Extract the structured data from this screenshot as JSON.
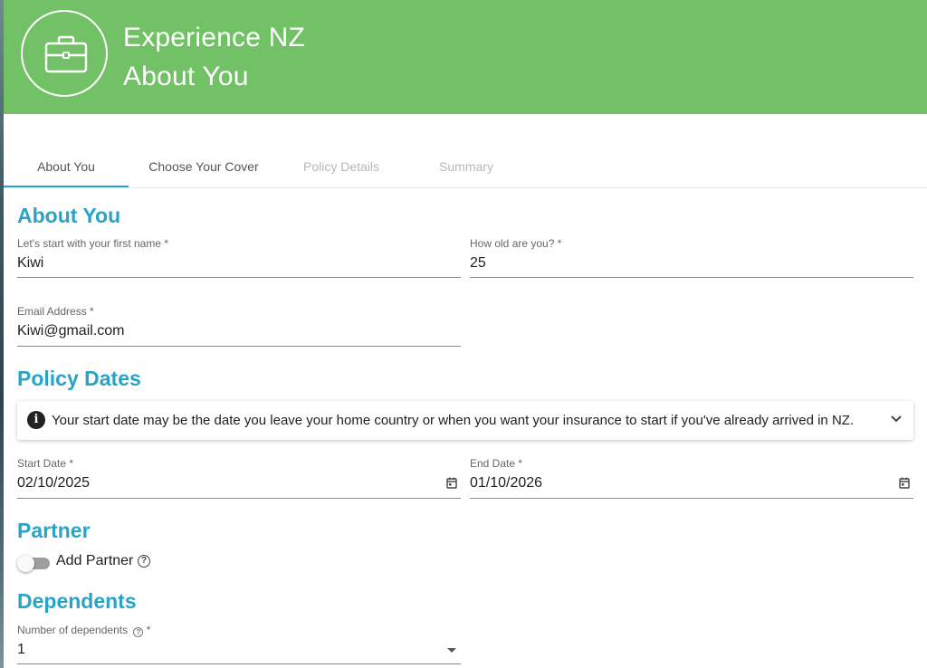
{
  "header": {
    "title_line1": "Experience NZ",
    "title_line2": "About You",
    "logo_icon": "briefcase-icon"
  },
  "tabs": [
    {
      "label": "About You",
      "state": "active"
    },
    {
      "label": "Choose Your Cover",
      "state": "enabled"
    },
    {
      "label": "Policy Details",
      "state": "disabled"
    },
    {
      "label": "Summary",
      "state": "disabled"
    }
  ],
  "about": {
    "title": "About You",
    "first_name": {
      "label": "Let's start with your first name *",
      "value": "Kiwi"
    },
    "age": {
      "label": "How old are you? *",
      "value": "25"
    },
    "email": {
      "label": "Email Address *",
      "value": "Kiwi@gmail.com"
    }
  },
  "policy_dates": {
    "title": "Policy Dates",
    "info": "Your start date may be the date you leave your home country or when you want your insurance to start if you've already arrived in NZ.",
    "start": {
      "label": "Start Date *",
      "value": "02/10/2025"
    },
    "end": {
      "label": "End Date *",
      "value": "01/10/2026"
    }
  },
  "partner": {
    "title": "Partner",
    "toggle_label": "Add Partner",
    "toggle_on": false
  },
  "dependents": {
    "title": "Dependents",
    "label": "Number of dependents",
    "required_mark": "*",
    "value": "1"
  },
  "colors": {
    "header_green": "#73c167",
    "accent_blue": "#29a3c8"
  }
}
